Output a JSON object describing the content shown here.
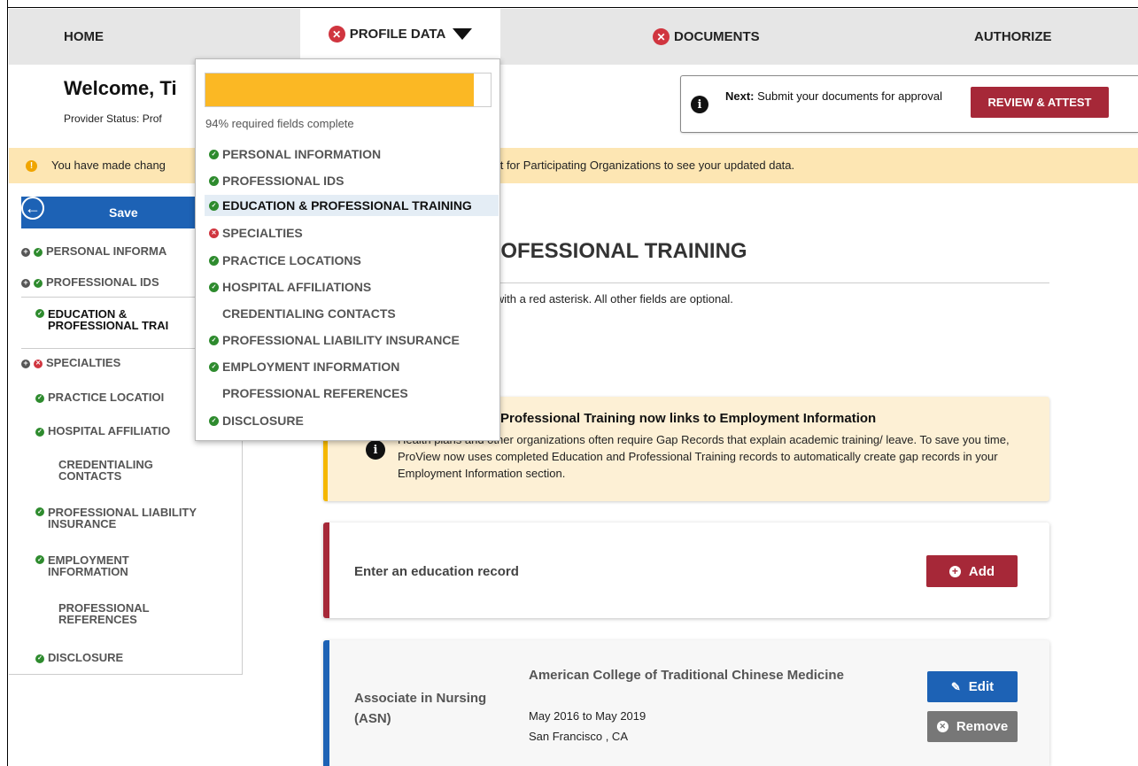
{
  "nav": {
    "home": "HOME",
    "profile_data": "PROFILE DATA",
    "documents": "DOCUMENTS",
    "authorize": "AUTHORIZE"
  },
  "welcome": {
    "title": "Welcome, Ti",
    "status": "Provider Status: Prof"
  },
  "next_box": {
    "next_label": "Next:",
    "next_text": " Submit your documents for approval",
    "button": "REVIEW & ATTEST"
  },
  "warning": {
    "text_left": "You have made chang",
    "text_right": "u must attest for Participating Organizations to see your updated data."
  },
  "sidebar": {
    "save": "Save",
    "items": [
      {
        "label": "PERSONAL INFORMA"
      },
      {
        "label": "PROFESSIONAL IDS"
      },
      {
        "label": "EDUCATION & PROFESSIONAL TRAI"
      },
      {
        "label": "SPECIALTIES"
      },
      {
        "label": "PRACTICE LOCATIOI"
      },
      {
        "label": "HOSPITAL AFFILIATIO"
      },
      {
        "label": "CREDENTIALING CONTACTS"
      },
      {
        "label": "PROFESSIONAL LIABILITY INSURANCE"
      },
      {
        "label": "EMPLOYMENT INFORMATION"
      },
      {
        "label": "PROFESSIONAL REFERENCES"
      },
      {
        "label": "DISCLOSURE"
      }
    ]
  },
  "main": {
    "heading": "ROFESSIONAL TRAINING",
    "required_note": "d with a red asterisk. All other fields are optional.",
    "info_title": "Professional Training now links to Employment Information",
    "info_body": "Health plans and other organizations often require Gap Records that explain academic training/ leave. To save you time, ProView now uses completed Education and Professional Training records to automatically create gap records in your Employment Information section.",
    "edu_label": "Enter an education record",
    "add_button": "Add",
    "record": {
      "degree": "Associate in Nursing (ASN)",
      "school": "American College of Traditional Chinese Medicine",
      "dates": "May 2016 to May 2019",
      "location": "San Francisco , CA",
      "edit_button": "Edit",
      "remove_button": "Remove"
    }
  },
  "dropdown": {
    "progress_percent": 94,
    "progress_text": "94% required fields complete",
    "items": [
      {
        "label": "PERSONAL INFORMATION",
        "status": "complete"
      },
      {
        "label": "PROFESSIONAL IDS",
        "status": "complete"
      },
      {
        "label": "EDUCATION & PROFESSIONAL TRAINING",
        "status": "complete"
      },
      {
        "label": "SPECIALTIES",
        "status": "error"
      },
      {
        "label": "PRACTICE LOCATIONS",
        "status": "complete"
      },
      {
        "label": "HOSPITAL AFFILIATIONS",
        "status": "complete"
      },
      {
        "label": "CREDENTIALING CONTACTS",
        "status": "none"
      },
      {
        "label": "PROFESSIONAL LIABILITY INSURANCE",
        "status": "complete"
      },
      {
        "label": "EMPLOYMENT INFORMATION",
        "status": "complete"
      },
      {
        "label": "PROFESSIONAL REFERENCES",
        "status": "none"
      },
      {
        "label": "DISCLOSURE",
        "status": "complete"
      }
    ]
  },
  "colors": {
    "brand_red": "#a62838",
    "brand_blue": "#1d62b5",
    "progress_yellow": "#fbb824",
    "complete_green": "#2e8b2e",
    "error_red": "#d0353f"
  }
}
